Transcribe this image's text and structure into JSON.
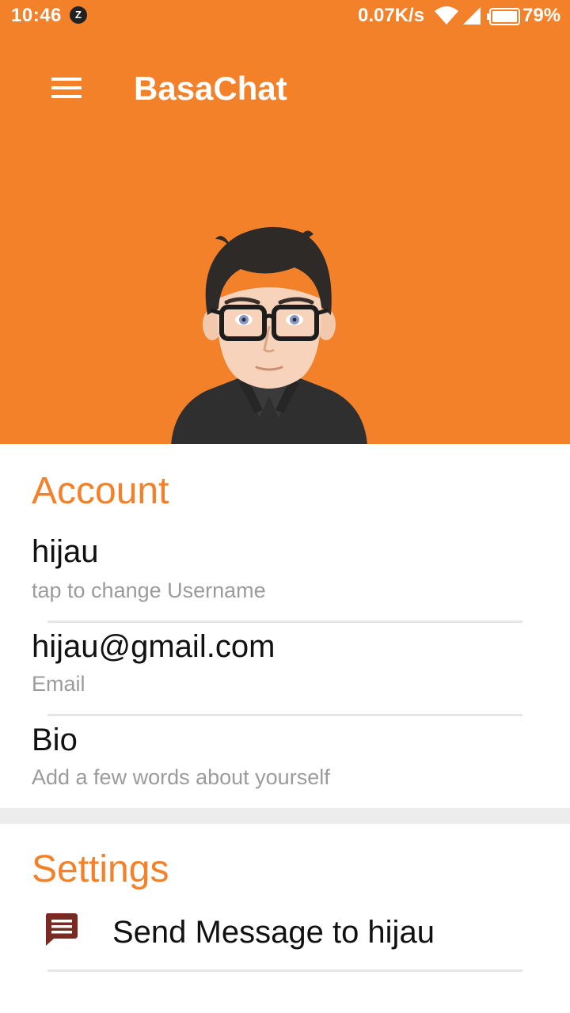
{
  "status_bar": {
    "time": "10:46",
    "notification_glyph": "Z",
    "network_speed": "0.07K/s",
    "battery": "79%"
  },
  "toolbar": {
    "title": "BasaChat",
    "menu_icon": "hamburger-menu-icon"
  },
  "colors": {
    "accent": "#F3812A",
    "secondary_text": "#9b9b9b",
    "message_icon": "#7a2a22"
  },
  "account": {
    "title": "Account",
    "username": {
      "value": "hijau",
      "label": "tap to change Username"
    },
    "email": {
      "value": "hijau@gmail.com",
      "label": "Email"
    },
    "bio": {
      "value": "Bio",
      "label": "Add a few words about yourself"
    }
  },
  "settings": {
    "title": "Settings",
    "send_message": {
      "label": "Send Message to hijau",
      "icon": "message-icon"
    }
  }
}
